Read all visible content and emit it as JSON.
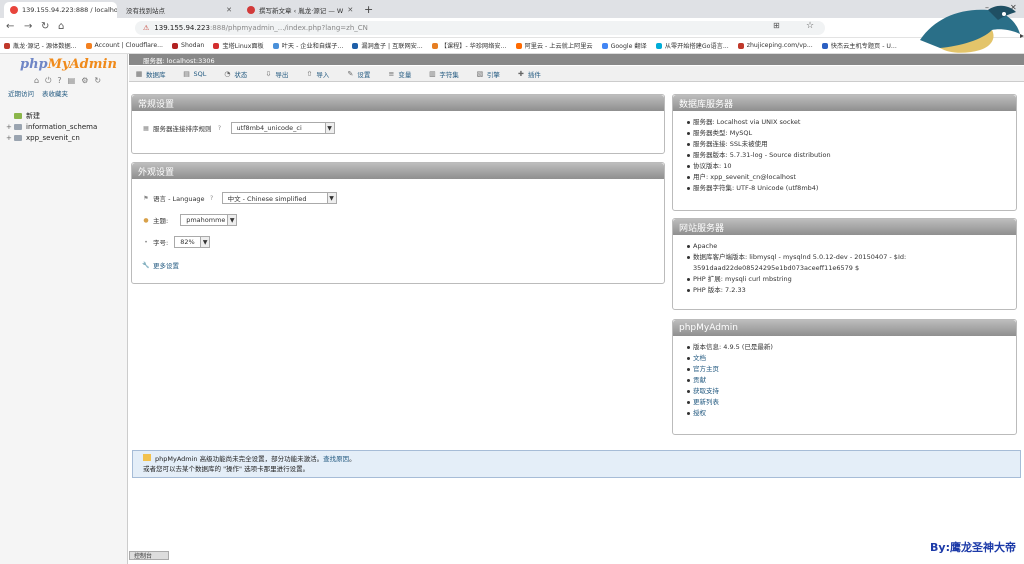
{
  "browser": {
    "tabs": [
      {
        "label": "139.155.94.223:888 / localhost",
        "active": true
      },
      {
        "label": "没有找到站点",
        "active": false
      },
      {
        "label": "撰写新文章 ‹ 胤龙·源记 — W",
        "active": false
      }
    ],
    "url_host": "139.155.94.223",
    "url_rest": ":888/phpmyadmin_.../index.php?lang=zh_CN",
    "bookmarks": [
      {
        "label": "胤龙·源记 - 源体数据...",
        "color": "#c0392b"
      },
      {
        "label": "Account | Cloudflare...",
        "color": "#f38020"
      },
      {
        "label": "Shodan",
        "color": "#b22222"
      },
      {
        "label": "宝塔Linux面板",
        "color": "#d32f2f"
      },
      {
        "label": "叶天 - 企业和自媒子...",
        "color": "#4a90d9"
      },
      {
        "label": "漏洞盒子 | 互联网安...",
        "color": "#1f5fa8"
      },
      {
        "label": "【课程】- 华珍网络安...",
        "color": "#e67e22"
      },
      {
        "label": "阿里云 - 上云就上阿里云",
        "color": "#ff6a00"
      },
      {
        "label": "Google 翻译",
        "color": "#4285f4"
      },
      {
        "label": "从零开始搭建Go语言...",
        "color": "#00add8"
      },
      {
        "label": "zhujiceping.com/vp...",
        "color": "#c0392b"
      },
      {
        "label": "快杰云主机专题页 - U...",
        "color": "#2b5fc2"
      }
    ]
  },
  "sidebar": {
    "logo_php": "php",
    "logo_myadmin": "MyAdmin",
    "links": [
      "近期访问",
      "表收藏夹"
    ],
    "tree": [
      {
        "label": "新建",
        "expander": ""
      },
      {
        "label": "information_schema",
        "expander": "+"
      },
      {
        "label": "xpp_sevenit_cn",
        "expander": "+"
      }
    ]
  },
  "main": {
    "server_crumb": "服务器: localhost:3306",
    "menu": [
      {
        "label": "数据库",
        "icon": "database-icon"
      },
      {
        "label": "SQL",
        "icon": "sql-icon"
      },
      {
        "label": "状态",
        "icon": "status-icon"
      },
      {
        "label": "导出",
        "icon": "export-icon"
      },
      {
        "label": "导入",
        "icon": "import-icon"
      },
      {
        "label": "设置",
        "icon": "settings-icon"
      },
      {
        "label": "变量",
        "icon": "variables-icon"
      },
      {
        "label": "字符集",
        "icon": "charset-icon"
      },
      {
        "label": "引擎",
        "icon": "engine-icon"
      },
      {
        "label": "插件",
        "icon": "plugin-icon"
      }
    ],
    "general_settings": {
      "title": "常规设置",
      "collation_label": "服务器连接排序规则",
      "collation_value": "utf8mb4_unicode_ci"
    },
    "appearance_settings": {
      "title": "外观设置",
      "language_label": "语言 - Language",
      "language_value": "中文 - Chinese simplified",
      "theme_label": "主题:",
      "theme_value": "pmahomme",
      "fontsize_label": "字号:",
      "fontsize_value": "82%",
      "more_settings": "更多设置"
    },
    "db_server": {
      "title": "数据库服务器",
      "items": [
        "服务器: Localhost via UNIX socket",
        "服务器类型: MySQL",
        "服务器连接: SSL未被使用",
        "服务器版本: 5.7.31-log - Source distribution",
        "协议版本: 10",
        "用户: xpp_sevenit_cn@localhost",
        "服务器字符集: UTF-8 Unicode (utf8mb4)"
      ]
    },
    "web_server": {
      "title": "网站服务器",
      "items": [
        "Apache",
        "数据库客户端版本: libmysql - mysqlnd 5.0.12-dev - 20150407 - $Id: 3591daad22de08524295e1bd073aceeff11e6579 $",
        "PHP 扩展: mysqli  curl  mbstring",
        "PHP 版本: 7.2.33"
      ]
    },
    "pma_info": {
      "title": "phpMyAdmin",
      "items": [
        "版本信息: 4.9.5 (已是最新)",
        "文档",
        "官方主页",
        "贡献",
        "获取支持",
        "更新列表",
        "授权"
      ]
    },
    "notice": {
      "line1_prefix": "phpMyAdmin 高级功能尚未完全设置，部分功能未激活。",
      "line1_link": "查找原因",
      "line1_suffix": "。",
      "line2": "或者您可以去某个数据库的 \"操作\" 选项卡那里进行设置。"
    },
    "console_label": "控制台"
  },
  "watermark": "By:鹰龙圣神大帝",
  "colors": {
    "link": "#235a81",
    "panel_header": "#8f8f8f",
    "notice_bg": "#e4eef8"
  }
}
